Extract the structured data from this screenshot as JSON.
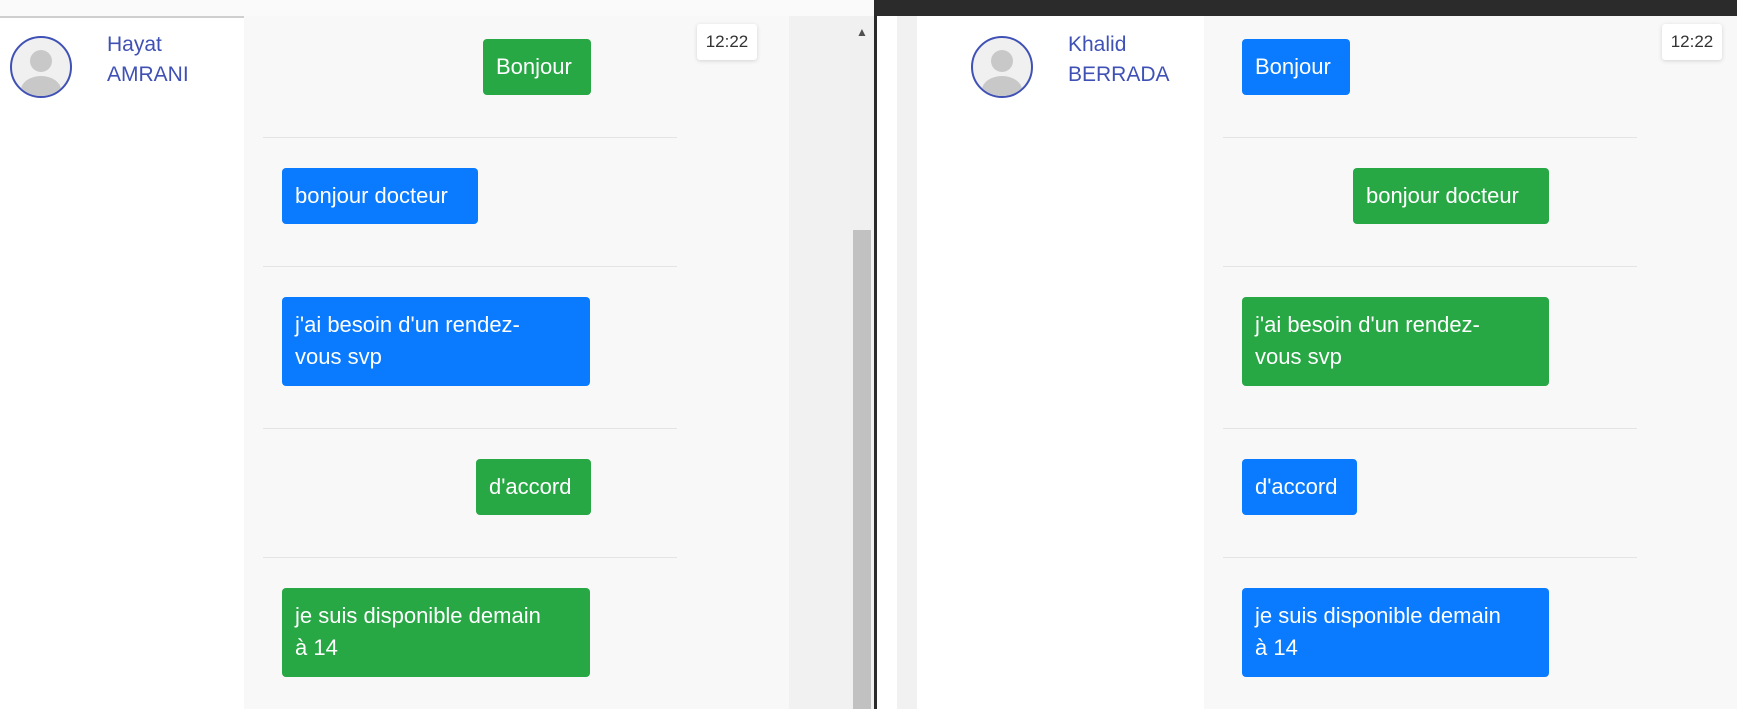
{
  "left": {
    "contact": {
      "first_name": "Hayat",
      "last_name": "AMRANI",
      "name": "Hayat\nAMRANI"
    },
    "time": "12:22",
    "messages": [
      {
        "text": "Bonjour",
        "color": "#28a745",
        "side": "right"
      },
      {
        "text": "bonjour docteur",
        "color": "#0a7bff",
        "side": "left"
      },
      {
        "text": "j'ai besoin d'un rendez-\nvous svp",
        "color": "#0a7bff",
        "side": "left"
      },
      {
        "text": "d'accord",
        "color": "#28a745",
        "side": "right"
      },
      {
        "text": "je suis disponible demain\nà 14",
        "color": "#28a745",
        "side": "left"
      }
    ]
  },
  "right": {
    "contact": {
      "first_name": "Khalid",
      "last_name": "BERRADA",
      "name": "Khalid\nBERRADA"
    },
    "time": "12:22",
    "messages": [
      {
        "text": "Bonjour",
        "color": "#0a7bff",
        "side": "left"
      },
      {
        "text": "bonjour docteur",
        "color": "#28a745",
        "side": "right"
      },
      {
        "text": "j'ai besoin d'un rendez-\nvous svp",
        "color": "#28a745",
        "side": "left"
      },
      {
        "text": "d'accord",
        "color": "#0a7bff",
        "side": "left"
      },
      {
        "text": "je suis disponible demain\nà 14",
        "color": "#0a7bff",
        "side": "left"
      }
    ]
  },
  "colors": {
    "accent": "#3f51b5",
    "green": "#28a745",
    "blue": "#0a7bff"
  }
}
